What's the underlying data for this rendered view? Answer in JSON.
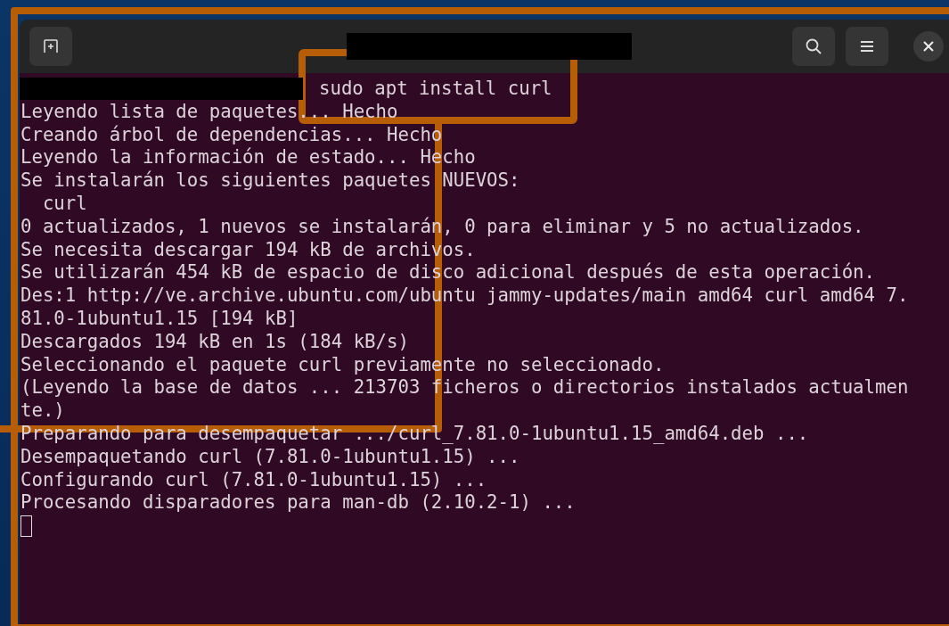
{
  "terminal": {
    "command": "sudo apt install curl",
    "lines": [
      "Leyendo lista de paquetes... Hecho",
      "Creando árbol de dependencias... Hecho",
      "Leyendo la información de estado... Hecho",
      "Se instalarán los siguientes paquetes NUEVOS:",
      "  curl",
      "0 actualizados, 1 nuevos se instalarán, 0 para eliminar y 5 no actualizados.",
      "Se necesita descargar 194 kB de archivos.",
      "Se utilizarán 454 kB de espacio de disco adicional después de esta operación.",
      "Des:1 http://ve.archive.ubuntu.com/ubuntu jammy-updates/main amd64 curl amd64 7.",
      "81.0-1ubuntu1.15 [194 kB]",
      "Descargados 194 kB en 1s (184 kB/s)",
      "Seleccionando el paquete curl previamente no seleccionado.",
      "(Leyendo la base de datos ... 213703 ficheros o directorios instalados actualmen",
      "te.)",
      "Preparando para desempaquetar .../curl_7.81.0-1ubuntu1.15_amd64.deb ...",
      "Desempaquetando curl (7.81.0-1ubuntu1.15) ...",
      "Configurando curl (7.81.0-1ubuntu1.15) ...",
      "Procesando disparadores para man-db (2.10.2-1) ..."
    ]
  }
}
